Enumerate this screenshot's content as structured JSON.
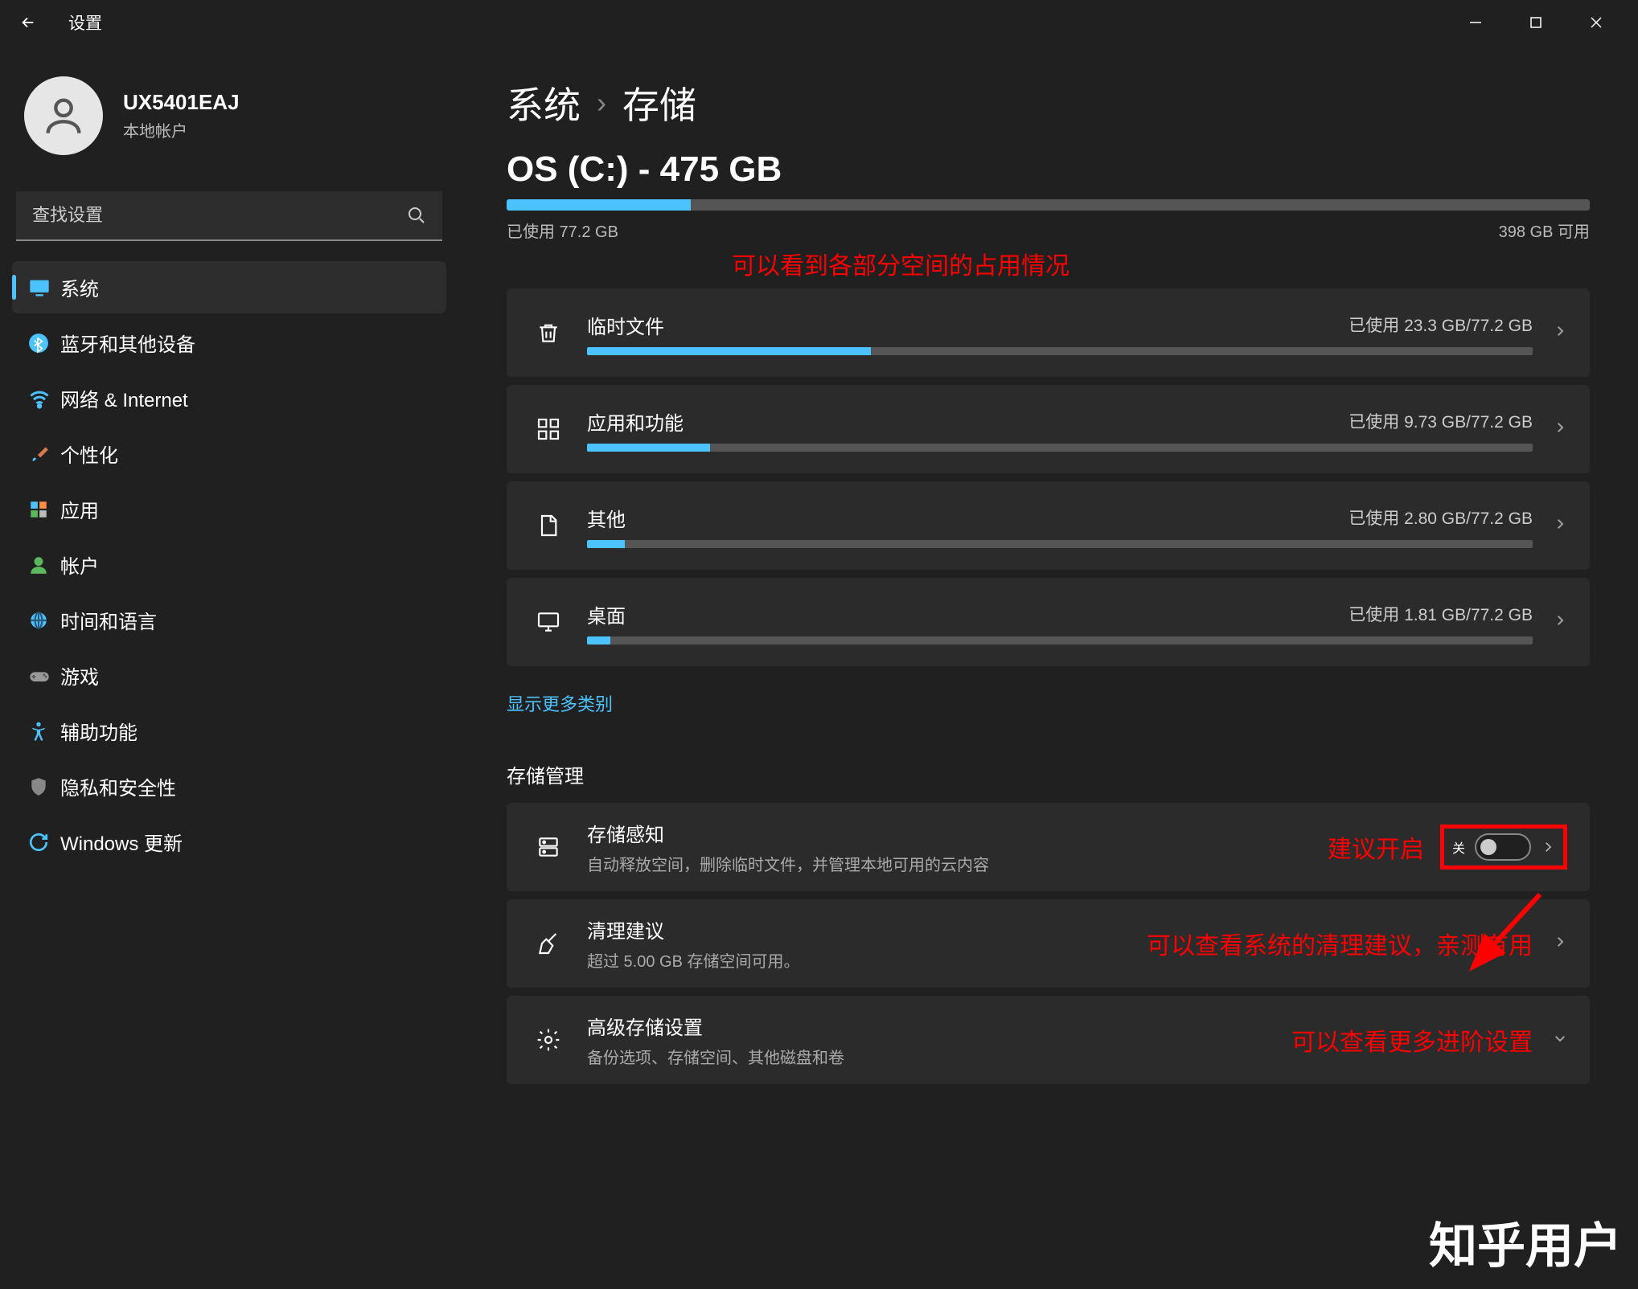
{
  "titlebar": {
    "title": "设置"
  },
  "profile": {
    "name": "UX5401EAJ",
    "sub": "本地帐户"
  },
  "search": {
    "placeholder": "查找设置"
  },
  "nav": [
    {
      "label": "系统",
      "icon": "display-icon",
      "active": true
    },
    {
      "label": "蓝牙和其他设备",
      "icon": "bluetooth-icon"
    },
    {
      "label": "网络 & Internet",
      "icon": "wifi-icon"
    },
    {
      "label": "个性化",
      "icon": "brush-icon"
    },
    {
      "label": "应用",
      "icon": "apps-icon"
    },
    {
      "label": "帐户",
      "icon": "person-icon"
    },
    {
      "label": "时间和语言",
      "icon": "globe-icon"
    },
    {
      "label": "游戏",
      "icon": "gamepad-icon"
    },
    {
      "label": "辅助功能",
      "icon": "accessibility-icon"
    },
    {
      "label": "隐私和安全性",
      "icon": "shield-icon"
    },
    {
      "label": "Windows 更新",
      "icon": "update-icon"
    }
  ],
  "breadcrumb": {
    "parent": "系统",
    "current": "存储"
  },
  "drive": {
    "title": "OS (C:) - 475 GB",
    "used_label": "已使用 77.2 GB",
    "free_label": "398 GB 可用",
    "fill_pct": 17
  },
  "categories": [
    {
      "title": "临时文件",
      "usage": "已使用 23.3 GB/77.2 GB",
      "pct": 30,
      "icon": "trash-icon"
    },
    {
      "title": "应用和功能",
      "usage": "已使用 9.73 GB/77.2 GB",
      "pct": 13,
      "icon": "apps-grid-icon"
    },
    {
      "title": "其他",
      "usage": "已使用 2.80 GB/77.2 GB",
      "pct": 4,
      "icon": "file-icon"
    },
    {
      "title": "桌面",
      "usage": "已使用 1.81 GB/77.2 GB",
      "pct": 2.5,
      "icon": "monitor-icon"
    }
  ],
  "more_link": "显示更多类别",
  "mgmt_title": "存储管理",
  "mgmt": [
    {
      "title": "存储感知",
      "sub": "自动释放空间，删除临时文件，并管理本地可用的云内容",
      "toggle": "关",
      "icon": "server-icon"
    },
    {
      "title": "清理建议",
      "sub": "超过 5.00 GB 存储空间可用。",
      "icon": "broom-icon"
    },
    {
      "title": "高级存储设置",
      "sub": "备份选项、存储空间、其他磁盘和卷",
      "icon": "gear-icon"
    }
  ],
  "annotations": {
    "a1": "可以看到各部分空间的占用情况",
    "a2": "建议开启",
    "a3": "可以查看系统的清理建议，亲测有用",
    "a4": "可以查看更多进阶设置"
  },
  "watermark": "知乎用户"
}
